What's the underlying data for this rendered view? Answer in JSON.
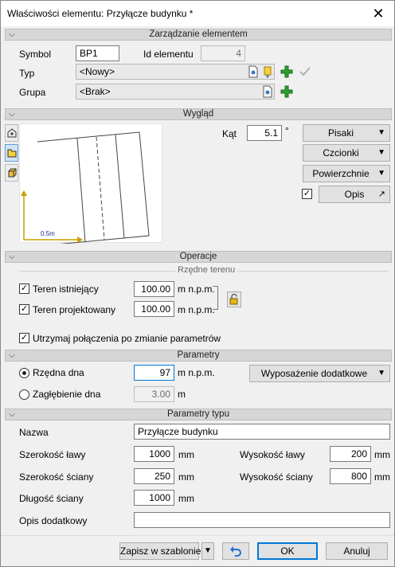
{
  "window": {
    "title": "Właściwości elementu: Przyłącze budynku *",
    "close": "✕"
  },
  "sections": {
    "management": "Zarządzanie elementem",
    "appearance": "Wygląd",
    "operations": "Operacje",
    "parameters": "Parametry",
    "type_parameters": "Parametry typu"
  },
  "management": {
    "symbol_label": "Symbol",
    "symbol_value": "BP1",
    "id_label": "Id elementu",
    "id_value": "4",
    "type_label": "Typ",
    "type_value": "<Nowy>",
    "group_label": "Grupa",
    "group_value": "<Brak>"
  },
  "appearance": {
    "angle_label": "Kąt",
    "angle_value": "5.1",
    "angle_unit": "°",
    "pens_button": "Pisaki",
    "fonts_button": "Czcionki",
    "surfaces_button": "Powierzchnie",
    "description_button": "Opis",
    "description_checked": true,
    "scale_label": "0.5m"
  },
  "operations": {
    "terrain_ordinates_label": "Rzędne terenu",
    "existing_terrain_label": "Teren istniejący",
    "existing_terrain_checked": true,
    "existing_terrain_value": "100.00",
    "designed_terrain_label": "Teren projektowany",
    "designed_terrain_checked": true,
    "designed_terrain_value": "100.00",
    "unit": "m n.p.m.",
    "keep_connections_label": "Utrzymaj połączenia po zmianie parametrów",
    "keep_connections_checked": true
  },
  "parameters": {
    "bottom_ordinate_label": "Rzędna dna",
    "bottom_ordinate_value": "97",
    "bottom_ordinate_unit": "m n.p.m.",
    "bottom_depth_label": "Zagłębienie dna",
    "bottom_depth_value": "3.00",
    "bottom_depth_unit": "m",
    "selected_mode": "bottom_ordinate",
    "equipment_button": "Wyposażenie dodatkowe"
  },
  "type_parameters": {
    "name_label": "Nazwa",
    "name_value": "Przyłącze budynku",
    "footing_width_label": "Szerokość ławy",
    "footing_width_value": "1000",
    "footing_height_label": "Wysokość ławy",
    "footing_height_value": "200",
    "wall_width_label": "Szerokość ściany",
    "wall_width_value": "250",
    "wall_height_label": "Wysokość ściany",
    "wall_height_value": "800",
    "wall_length_label": "Długość ściany",
    "wall_length_value": "1000",
    "unit": "mm",
    "extra_description_label": "Opis dodatkowy",
    "extra_description_value": ""
  },
  "footer": {
    "save_template": "Zapisz w szablonie",
    "ok": "OK",
    "cancel": "Anuluj"
  },
  "colors": {
    "accent": "#0078d7",
    "add_green": "#2e9e2e",
    "section_bg": "#d6d6d6"
  }
}
